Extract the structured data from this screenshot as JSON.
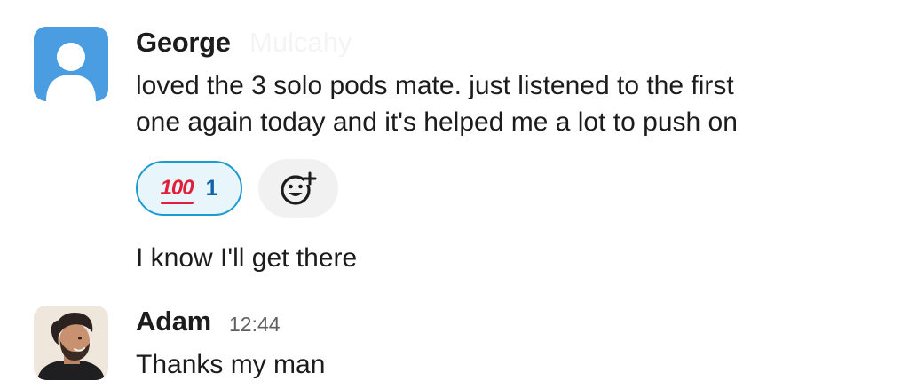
{
  "messages": [
    {
      "sender": "George",
      "faded_name": "Mulcahy",
      "lines": [
        "loved the 3 solo pods mate. just listened to the first",
        "one again today and it's helped me a lot to push on"
      ],
      "reactions": [
        {
          "emoji": "100",
          "emoji_icon": "hundred-points-icon",
          "count": "1",
          "selected": true
        }
      ],
      "followup": "I know I'll get there"
    },
    {
      "sender": "Adam",
      "time": "12:44",
      "lines": [
        "Thanks my man"
      ]
    }
  ],
  "colors": {
    "text": "#1d1c1d",
    "timestamp": "#616061",
    "reaction_border": "#1d9bd1",
    "reaction_bg": "#e8f5fa",
    "reaction_count": "#1264a3",
    "avatar_default": "#4a9de0",
    "hundred_red": "#e0203a"
  },
  "icons": {
    "add_reaction": "add-reaction-icon",
    "default_avatar": "default-avatar-icon"
  }
}
